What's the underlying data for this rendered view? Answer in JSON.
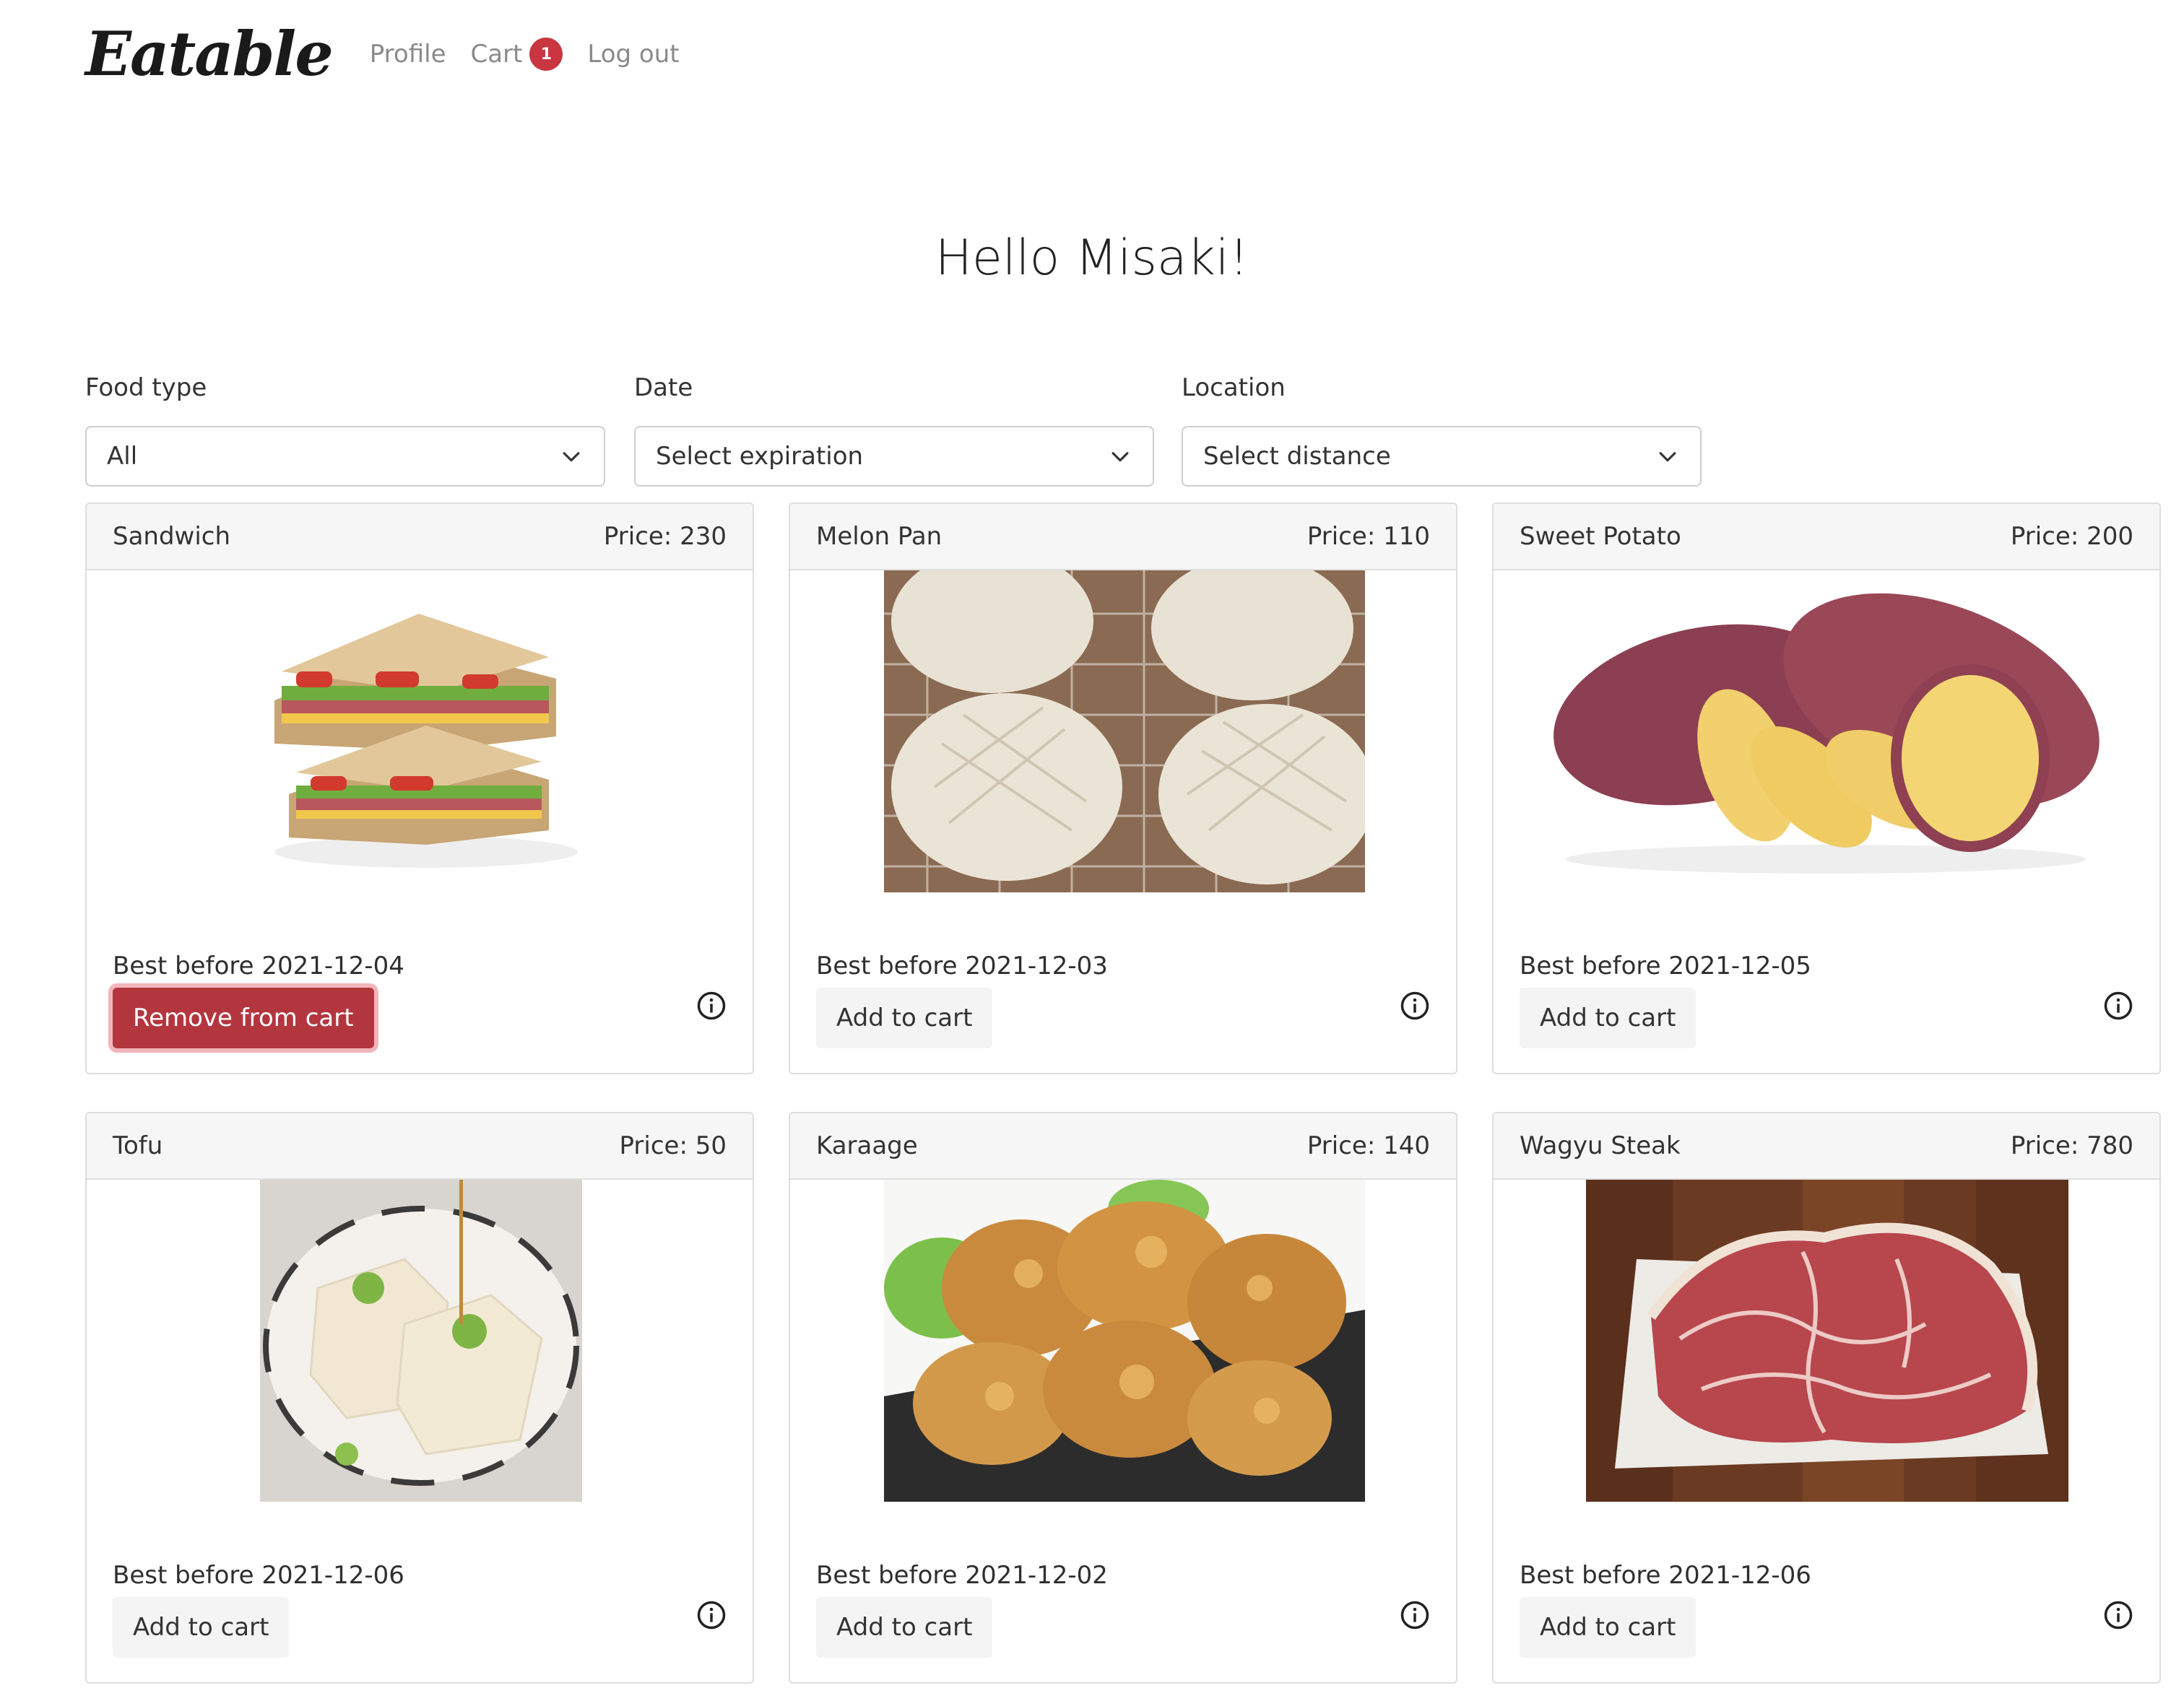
{
  "nav": {
    "logo": "Eatable",
    "links": [
      "Profile",
      "Cart",
      "Log out"
    ],
    "cart_count": "1"
  },
  "greeting": "Hello Misaki!",
  "filters": [
    {
      "label": "Food type",
      "value": "All"
    },
    {
      "label": "Date",
      "value": "Select expiration"
    },
    {
      "label": "Location",
      "value": "Select distance"
    }
  ],
  "cards": [
    {
      "name": "Sandwich",
      "price": "Price: 230",
      "best_before": "Best before 2021-12-04",
      "button": "Remove from cart",
      "image_icon": "sandwich-image"
    },
    {
      "name": "Melon Pan",
      "price": "Price: 110",
      "best_before": "Best before 2021-12-03",
      "button": "Add to cart",
      "image_icon": "melon-pan-image"
    },
    {
      "name": "Sweet Potato",
      "price": "Price: 200",
      "best_before": "Best before 2021-12-05",
      "button": "Add to cart",
      "image_icon": "sweet-potato-image"
    },
    {
      "name": "Tofu",
      "price": "Price: 50",
      "best_before": "Best before 2021-12-06",
      "button": "Add to cart",
      "image_icon": "tofu-image"
    },
    {
      "name": "Karaage",
      "price": "Price: 140",
      "best_before": "Best before 2021-12-02",
      "button": "Add to cart",
      "image_icon": "karaage-image"
    },
    {
      "name": "Wagyu Steak",
      "price": "Price: 780",
      "best_before": "Best before 2021-12-06",
      "button": "Add to cart",
      "image_icon": "wagyu-steak-image"
    }
  ],
  "colors": {
    "accent_red": "#b3363f",
    "badge_red": "#c9363f",
    "header_bg": "#f6f6f6",
    "button_bg": "#f4f4f4"
  }
}
